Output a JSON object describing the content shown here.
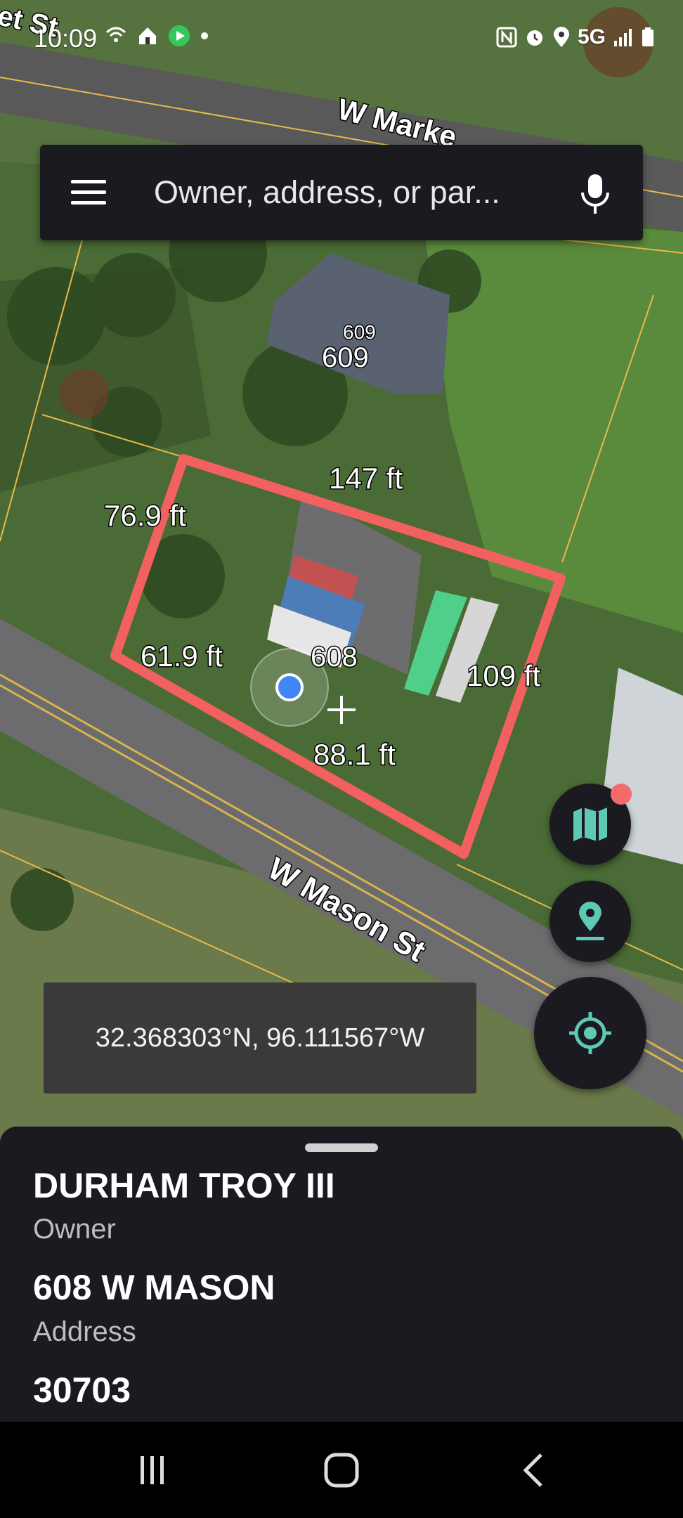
{
  "status_bar": {
    "time": "10:09",
    "network": "5G",
    "icons_left": [
      "wifi-calling-icon",
      "home-icon",
      "play-icon",
      "dot-icon"
    ],
    "icons_right": [
      "nfc-icon",
      "alarm-icon",
      "location-icon",
      "signal-icon",
      "battery-icon"
    ]
  },
  "search": {
    "placeholder": "Owner, address, or par..."
  },
  "map": {
    "street_labels": [
      "et St",
      "W Marke",
      "W Mason St"
    ],
    "parcel_numbers": [
      "609",
      "609",
      "608"
    ],
    "measurements": [
      "147 ft",
      "76.9 ft",
      "61.9 ft",
      "109 ft",
      "88.1 ft"
    ],
    "parcel_outline_color": "#f26060",
    "parcel_line_color": "#e8b94a"
  },
  "coordinates": "32.368303°N, 96.111567°W",
  "accent_color": "#5ec9b4",
  "panel": {
    "owner_value": "DURHAM TROY III",
    "owner_label": "Owner",
    "address_value": "608 W MASON",
    "address_label": "Address",
    "parcel_value": "30703"
  },
  "nav": {
    "buttons": [
      "recent-apps",
      "home",
      "back"
    ]
  }
}
